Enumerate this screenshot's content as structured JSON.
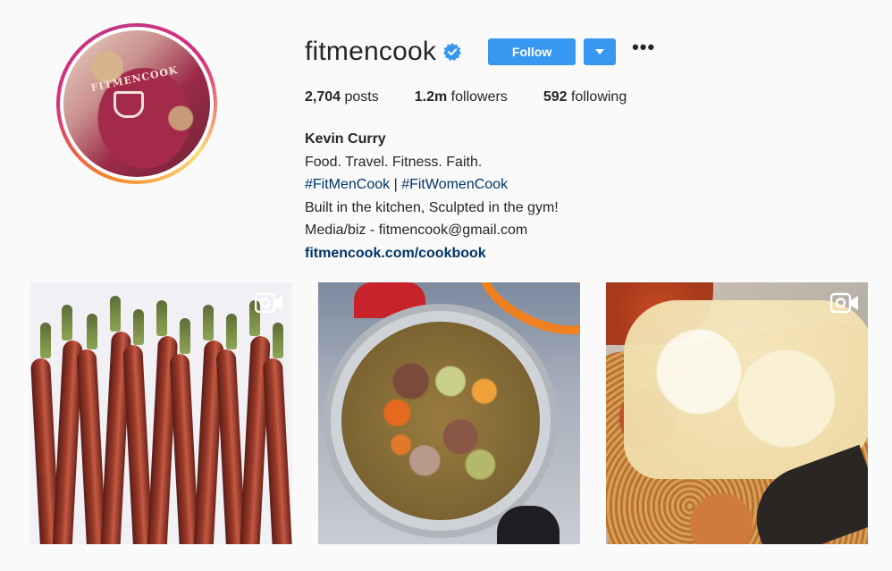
{
  "profile": {
    "username": "fitmencook",
    "verified": true,
    "follow_label": "Follow",
    "more_label": "•••",
    "avatar_text": "FITMENCOOK"
  },
  "stats": {
    "posts_count": "2,704",
    "posts_label": "posts",
    "followers_count": "1.2m",
    "followers_label": "followers",
    "following_count": "592",
    "following_label": "following"
  },
  "bio": {
    "full_name": "Kevin Curry",
    "line1": "Food. Travel. Fitness. Faith.",
    "hashtag1": "#FitMenCook",
    "separator": " | ",
    "hashtag2": "#FitWomenCook",
    "line3": "Built in the kitchen, Sculpted in the gym!",
    "line4": "Media/biz - fitmencook@gmail.com",
    "website": "fitmencook.com/cookbook"
  },
  "posts": [
    {
      "subject": "bacon-wrapped asparagus",
      "is_video": true
    },
    {
      "subject": "beef vegetable soup in jar",
      "is_video": false
    },
    {
      "subject": "eggplant parmesan",
      "is_video": true
    }
  ],
  "colors": {
    "accent": "#3897f0",
    "link": "#003569",
    "background": "#fafafa",
    "text": "#262626"
  }
}
